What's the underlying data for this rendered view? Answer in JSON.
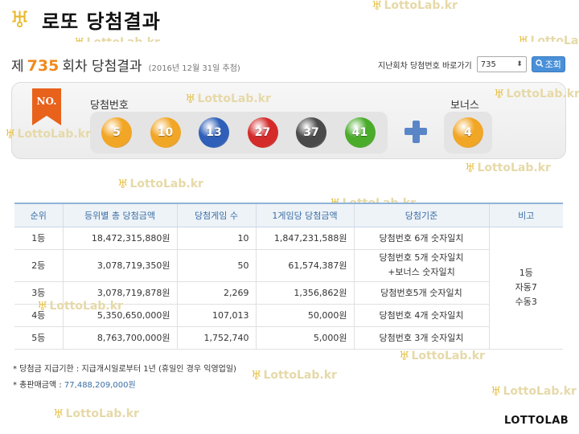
{
  "slide_title": "로또 당첨결과",
  "watermark": "LottoLab.kr",
  "header": {
    "prefix": "제",
    "draw_number": "735",
    "suffix": "회차 당첨결과",
    "date": "(2016년 12월 31일 추첨)"
  },
  "nav": {
    "label": "지난회차 당첨번호 바로가기",
    "select_value": "735",
    "select_arrow": "⬍",
    "button_label": "조회"
  },
  "ribbon_text": "NO.",
  "winning_label": "당첨번호",
  "bonus_label": "보너스",
  "balls": [
    {
      "number": "5",
      "color": "#f2a626"
    },
    {
      "number": "10",
      "color": "#f2a626"
    },
    {
      "number": "13",
      "color": "#2f5fb8"
    },
    {
      "number": "27",
      "color": "#d42a2a"
    },
    {
      "number": "37",
      "color": "#4a4a4a"
    },
    {
      "number": "41",
      "color": "#4aac2a"
    }
  ],
  "bonus_ball": {
    "number": "4",
    "color": "#f2a626"
  },
  "table": {
    "headers": [
      "순위",
      "등위별 총 당첨금액",
      "당첨게임 수",
      "1게임당 당첨금액",
      "당첨기준",
      "비고"
    ],
    "rows": [
      {
        "rank": "1등",
        "total": "18,472,315,880원",
        "count": "10",
        "per": "1,847,231,588원",
        "crit1": "당첨번호 6개 숫자일치",
        "crit2": ""
      },
      {
        "rank": "2등",
        "total": "3,078,719,350원",
        "count": "50",
        "per": "61,574,387원",
        "crit1": "당첨번호 5개 숫자일치",
        "crit2": "+보너스 숫자일치"
      },
      {
        "rank": "3등",
        "total": "3,078,719,878원",
        "count": "2,269",
        "per": "1,356,862원",
        "crit1": "당첨번호5개 숫자일치",
        "crit2": ""
      },
      {
        "rank": "4등",
        "total": "5,350,650,000원",
        "count": "107,013",
        "per": "50,000원",
        "crit1": "당첨번호 4개 숫자일치",
        "crit2": ""
      },
      {
        "rank": "5등",
        "total": "8,763,700,000원",
        "count": "1,752,740",
        "per": "5,000원",
        "crit1": "당첨번호 3개 숫자일치",
        "crit2": ""
      }
    ],
    "note": [
      "1등",
      "자동7",
      "수동3"
    ]
  },
  "footnotes": {
    "line1": "* 당첨금 지급기한 : 지급개시일로부터 1년 (휴일인 경우 익영업일)",
    "line2_label": "* 총판매금액 :",
    "line2_amount": "77,488,209,000원"
  },
  "logo": "LOTTOLAB"
}
